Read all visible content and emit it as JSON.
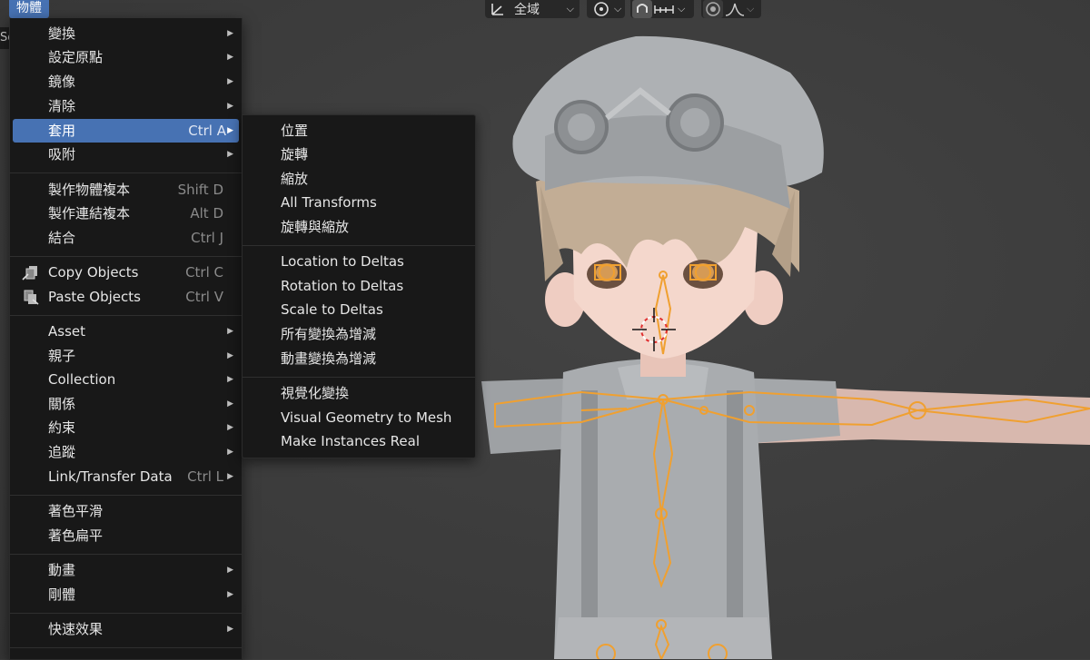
{
  "header": {
    "menu_title": "物體",
    "left_fragment": "Sc",
    "orientation_label": "全域"
  },
  "object_menu": [
    {
      "label": "變換",
      "has_submenu": true
    },
    {
      "label": "設定原點",
      "has_submenu": true
    },
    {
      "label": "鏡像",
      "has_submenu": true
    },
    {
      "label": "清除",
      "has_submenu": true
    },
    {
      "label": "套用",
      "shortcut": "Ctrl A",
      "has_submenu": true,
      "active": true
    },
    {
      "label": "吸附",
      "has_submenu": true
    },
    {
      "label": "製作物體複本",
      "shortcut": "Shift D"
    },
    {
      "label": "製作連結複本",
      "shortcut": "Alt D"
    },
    {
      "label": "結合",
      "shortcut": "Ctrl J"
    },
    {
      "label": "Copy Objects",
      "shortcut": "Ctrl C",
      "icon": "copy-icon"
    },
    {
      "label": "Paste Objects",
      "shortcut": "Ctrl V",
      "icon": "paste-icon"
    },
    {
      "label": "Asset",
      "has_submenu": true
    },
    {
      "label": "親子",
      "has_submenu": true
    },
    {
      "label": "Collection",
      "has_submenu": true
    },
    {
      "label": "關係",
      "has_submenu": true
    },
    {
      "label": "約束",
      "has_submenu": true
    },
    {
      "label": "追蹤",
      "has_submenu": true
    },
    {
      "label": "Link/Transfer Data",
      "shortcut": "Ctrl L",
      "has_submenu": true
    },
    {
      "label": "著色平滑"
    },
    {
      "label": "著色扁平"
    },
    {
      "label": "動畫",
      "has_submenu": true
    },
    {
      "label": "剛體",
      "has_submenu": true
    },
    {
      "label": "快速效果",
      "has_submenu": true
    }
  ],
  "apply_submenu": [
    {
      "label": "位置"
    },
    {
      "label": "旋轉"
    },
    {
      "label": "縮放"
    },
    {
      "label": "All Transforms"
    },
    {
      "label": "旋轉與縮放"
    },
    {
      "label": "Location to Deltas"
    },
    {
      "label": "Rotation to Deltas"
    },
    {
      "label": "Scale to Deltas"
    },
    {
      "label": "所有變換為增減"
    },
    {
      "label": "動畫變換為增減"
    },
    {
      "label": "視覺化變換"
    },
    {
      "label": "Visual Geometry to Mesh"
    },
    {
      "label": "Make Instances Real"
    }
  ],
  "colors": {
    "accent": "#4772b3",
    "menu_bg": "#181818",
    "armature": "#f0a030",
    "viewport_bg": "#3d3d3d"
  }
}
